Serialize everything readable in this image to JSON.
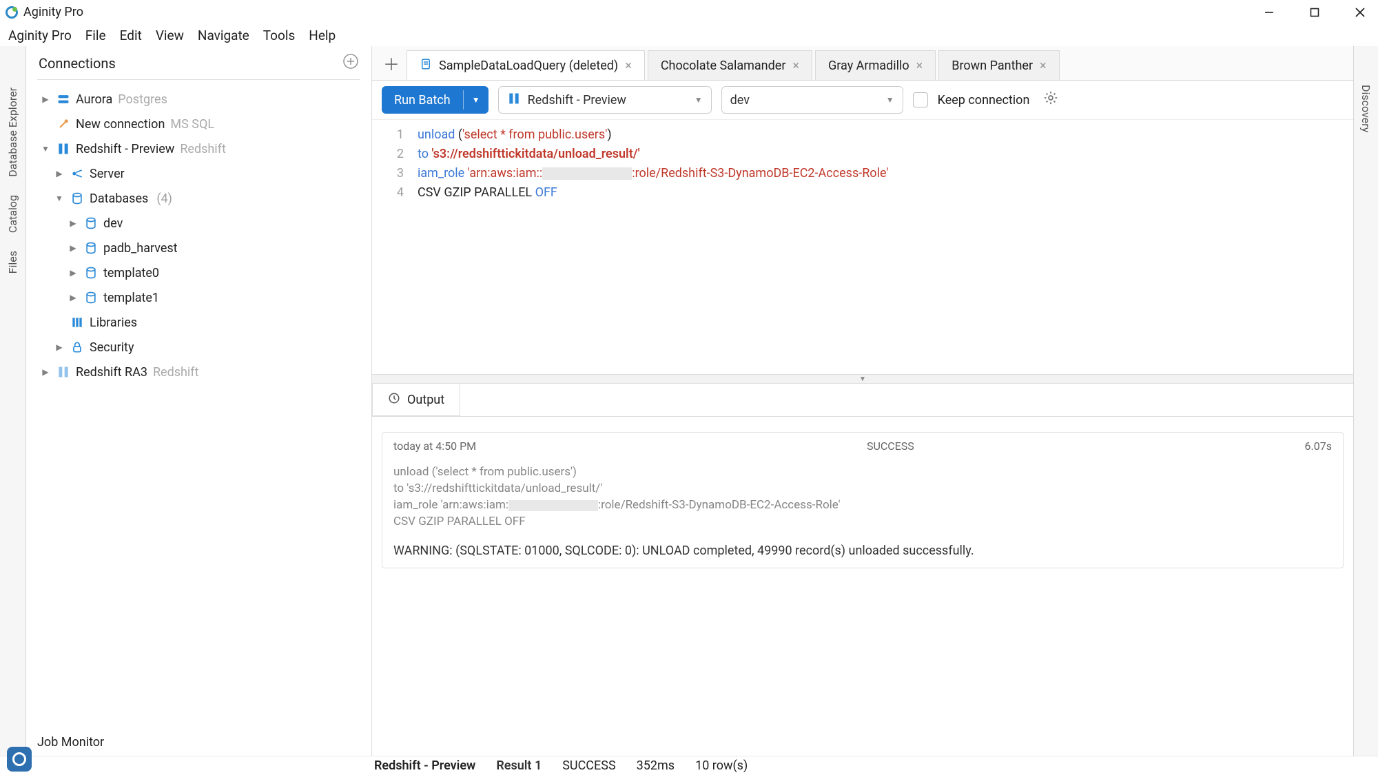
{
  "app": {
    "title": "Aginity Pro"
  },
  "menu": [
    "Aginity Pro",
    "File",
    "Edit",
    "View",
    "Navigate",
    "Tools",
    "Help"
  ],
  "leftrail": [
    "Database Explorer",
    "Catalog",
    "Files"
  ],
  "rightrail": "Discovery",
  "sidebar": {
    "title": "Connections",
    "items": [
      {
        "label": "Aurora",
        "sub": "Postgres"
      },
      {
        "label": "New connection",
        "sub": "MS SQL"
      },
      {
        "label": "Redshift - Preview",
        "sub": "Redshift",
        "expanded": true
      },
      {
        "label": "Server"
      },
      {
        "label": "Databases",
        "count": "(4)",
        "expanded": true
      },
      {
        "label": "dev"
      },
      {
        "label": "padb_harvest"
      },
      {
        "label": "template0"
      },
      {
        "label": "template1"
      },
      {
        "label": "Libraries"
      },
      {
        "label": "Security"
      },
      {
        "label": "Redshift RA3",
        "sub": "Redshift"
      }
    ],
    "footer": "Job Monitor"
  },
  "tabs": [
    "SampleDataLoadQuery (deleted)",
    "Chocolate Salamander",
    "Gray Armadillo",
    "Brown Panther"
  ],
  "toolbar": {
    "run": "Run Batch",
    "connection": "Redshift - Preview",
    "database": "dev",
    "keep": "Keep connection"
  },
  "editor": {
    "lines": [
      "1",
      "2",
      "3",
      "4"
    ],
    "l1_kw": "unload",
    "l1_open": " (",
    "l1_str": "'select * from public.users'",
    "l1_close": ")",
    "l2_kw": "to",
    "l2_sp": " ",
    "l2_str": "'s3://redshifttickitdata/unload_result/'",
    "l3_kw": "iam_role",
    "l3_sp": " ",
    "l3_s1": "'arn:aws:iam::",
    "l3_s2": ":role/Redshift-S3-DynamoDB-EC2-Access-Role'",
    "l4_p": "CSV GZIP PARALLEL ",
    "l4_kw": "OFF"
  },
  "bottomtabs": {
    "output": "Output"
  },
  "output": {
    "time": "today at 4:50 PM",
    "status": "SUCCESS",
    "duration": "6.07s",
    "q1": "unload ('select * from public.users')",
    "q2": "to 's3://redshifttickitdata/unload_result/'",
    "q3a": "iam_role 'arn:aws:iam:",
    "q3b": ":role/Redshift-S3-DynamoDB-EC2-Access-Role'",
    "q4": "CSV GZIP PARALLEL OFF",
    "warn": "WARNING: (SQLSTATE: 01000, SQLCODE: 0): UNLOAD completed, 49990 record(s) unloaded successfully."
  },
  "status": {
    "conn": "Redshift - Preview",
    "result": "Result 1",
    "state": "SUCCESS",
    "ms": "352ms",
    "rows": "10 row(s)"
  }
}
